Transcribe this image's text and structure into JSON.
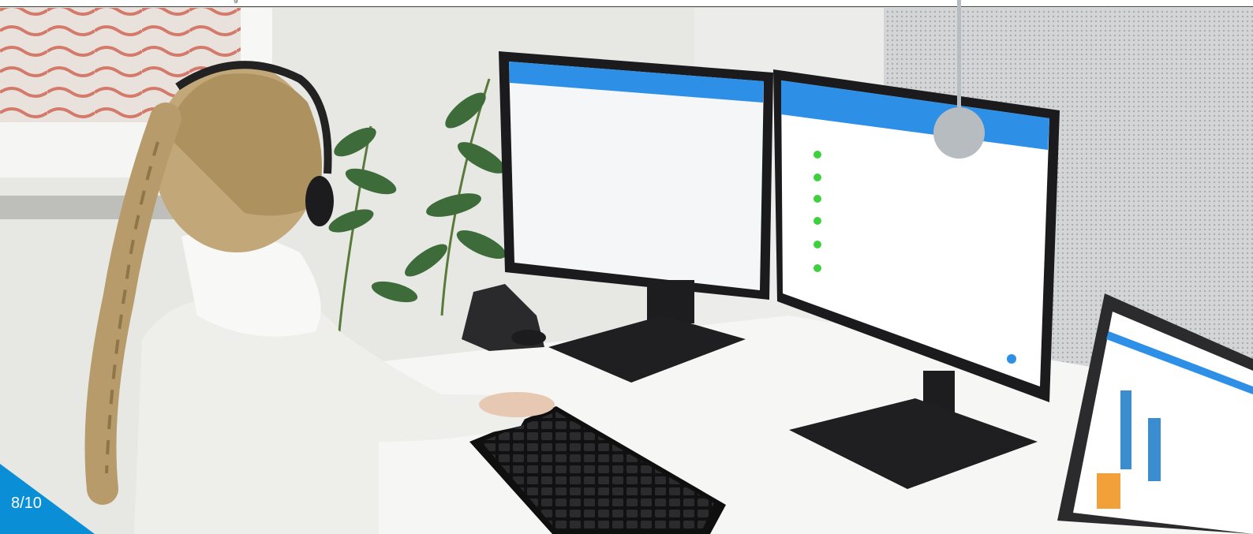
{
  "page_counter": "8/10",
  "header_fragment": "g",
  "colors": {
    "accent": "#0a8fd7",
    "marker": "#b7bcc1",
    "wall": "#e8e8e4",
    "desk": "#f4f4f2",
    "monitor": "#1a1a1c",
    "app_header": "#2d8fe6",
    "sweater": "#efefeb",
    "hair": "#b59a6a",
    "plant": "#3e6b3a"
  },
  "icons": {
    "marker": "hotspot-marker-icon",
    "headset": "headset-icon",
    "phone": "desk-phone-icon",
    "keyboard": "keyboard-icon"
  }
}
